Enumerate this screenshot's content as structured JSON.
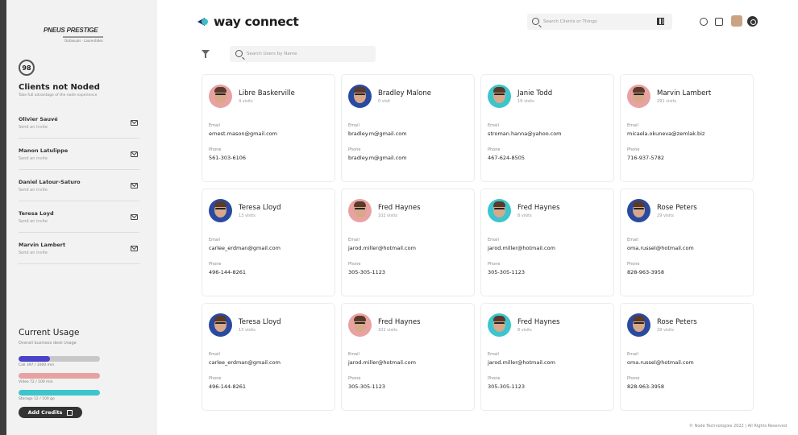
{
  "sidebar": {
    "logo_text": "PNEUS PRESTIGE",
    "logo_sub": "Outaouais · Laurentides",
    "not_noded_count": "98",
    "title": "Clients not Noded",
    "subtitle": "Take full advantage of the node experience",
    "clients": [
      {
        "name": "Olivier Sauvé",
        "action": "Send an invite"
      },
      {
        "name": "Manon Latulippe",
        "action": "Send an invite"
      },
      {
        "name": "Daniel Latour-Saturo",
        "action": "Send an invite"
      },
      {
        "name": "Teresa Loyd",
        "action": "Send an invite"
      },
      {
        "name": "Marvin Lambert",
        "action": "Send an invite"
      }
    ],
    "usage": {
      "title": "Current Usage",
      "subtitle": "Overall business desk Usage",
      "bars": [
        {
          "label": "Call 397 / 1000 min",
          "fraction": 0.39,
          "color": "#4a42c8"
        },
        {
          "label": "Video 72 / 100 min",
          "fraction": 1.0,
          "color": "#e8a2a2"
        },
        {
          "label": "Storage 12 / 100 go",
          "fraction": 1.0,
          "color": "#3cc5cc"
        }
      ],
      "button_label": "Add Credits"
    }
  },
  "header": {
    "brand": "way connect",
    "search_placeholder": "Search Clients or Things"
  },
  "toolbar": {
    "search_placeholder": "Search Users by Name"
  },
  "cards": [
    {
      "name": "Libre Baskerville",
      "visits": "4 visits",
      "email": "ernest.mason@gmail.com",
      "phone": "561-303-6106",
      "avatar_bg": "#e8a2a2"
    },
    {
      "name": "Bradley Malone",
      "visits": "0 visit",
      "email": "bradley.m@gmail.com",
      "phone": "bradley.m@gmail.com",
      "avatar_bg": "#2a4aa0"
    },
    {
      "name": "Janie Todd",
      "visits": "19 visits",
      "email": "stroman.hanna@yahoo.com",
      "phone": "467-624-8505",
      "avatar_bg": "#3cc5cc"
    },
    {
      "name": "Marvin Lambert",
      "visits": "291 visits",
      "email": "micaela.okuneva@zemlak.biz",
      "phone": "716-937-5782",
      "avatar_bg": "#e8a2a2"
    },
    {
      "name": "Teresa Lloyd",
      "visits": "13 visits",
      "email": "carlee_erdman@gmail.com",
      "phone": "496-144-8261",
      "avatar_bg": "#2a4aa0"
    },
    {
      "name": "Fred Haynes",
      "visits": "102 visits",
      "email": "jarod.miller@hotmail.com",
      "phone": "305-305-1123",
      "avatar_bg": "#e8a2a2"
    },
    {
      "name": "Fred Haynes",
      "visits": "8 visits",
      "email": "jarod.miller@hotmail.com",
      "phone": "305-305-1123",
      "avatar_bg": "#3cc5cc"
    },
    {
      "name": "Rose Peters",
      "visits": "29 visits",
      "email": "oma.russel@hotmail.com",
      "phone": "828-963-3958",
      "avatar_bg": "#2a4aa0"
    },
    {
      "name": "Teresa Lloyd",
      "visits": "13 visits",
      "email": "carlee_erdman@gmail.com",
      "phone": "496-144-8261",
      "avatar_bg": "#2a4aa0"
    },
    {
      "name": "Fred Haynes",
      "visits": "102 visits",
      "email": "jarod.miller@hotmail.com",
      "phone": "305-305-1123",
      "avatar_bg": "#e8a2a2"
    },
    {
      "name": "Fred Haynes",
      "visits": "8 visits",
      "email": "jarod.miller@hotmail.com",
      "phone": "305-305-1123",
      "avatar_bg": "#3cc5cc"
    },
    {
      "name": "Rose Peters",
      "visits": "29 visits",
      "email": "oma.russel@hotmail.com",
      "phone": "828-963-3958",
      "avatar_bg": "#2a4aa0"
    }
  ],
  "card_labels": {
    "email": "Email",
    "phone": "Phone"
  },
  "footer": "© Node Technologies 2022 | All Rights Reserved"
}
